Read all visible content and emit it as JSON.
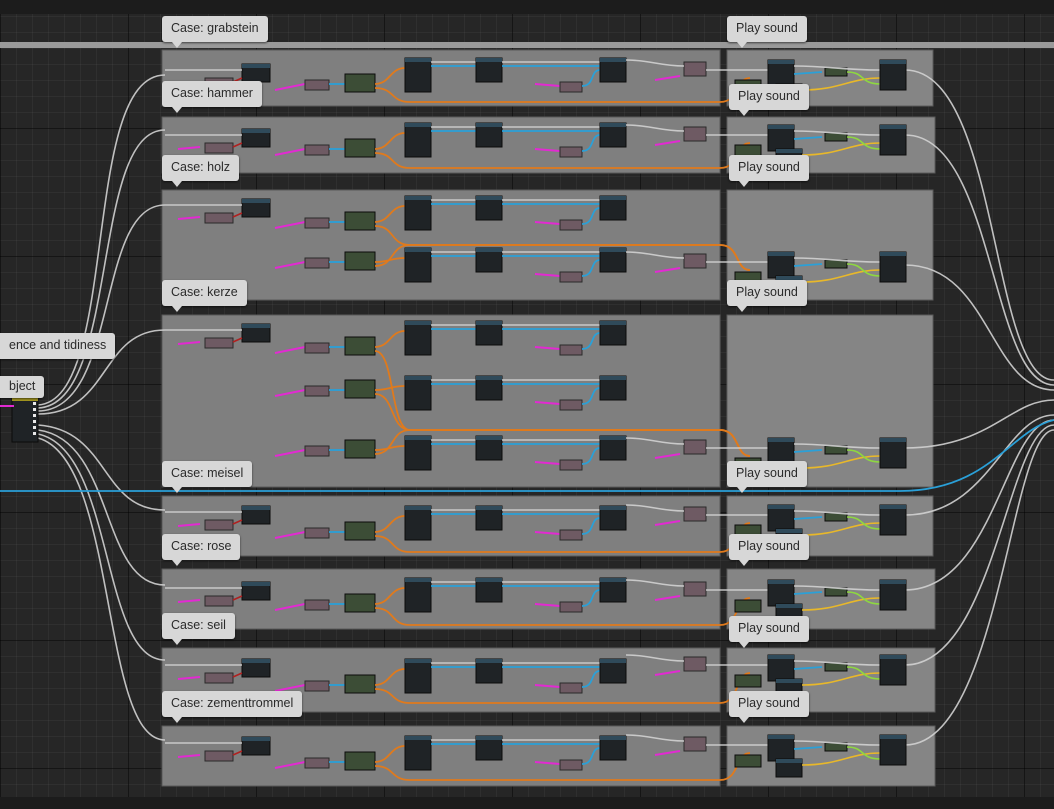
{
  "graph": {
    "comments": {
      "left_partial": "ence and tidiness",
      "object_partial": "bject"
    },
    "cases": [
      {
        "label": "Case: grabstein",
        "sound_label": "Play sound"
      },
      {
        "label": "Case: hammer",
        "sound_label": "Play sound"
      },
      {
        "label": "Case: holz",
        "sound_label": "Play sound"
      },
      {
        "label": "Case: kerze",
        "sound_label": "Play sound"
      },
      {
        "label": "Case: meisel",
        "sound_label": "Play sound"
      },
      {
        "label": "Case: rose",
        "sound_label": "Play sound"
      },
      {
        "label": "Case: seil",
        "sound_label": "Play sound"
      },
      {
        "label": "Case: zementtrommel",
        "sound_label": "Play sound"
      }
    ],
    "colors": {
      "exec_wire": "#d2d2d2",
      "float_wire": "#2aa0d8",
      "bool_wire": "#e07a1c",
      "object_wire": "#e22ad2",
      "vector_wire": "#e8b82a",
      "struct_wire": "#8ed840"
    }
  }
}
